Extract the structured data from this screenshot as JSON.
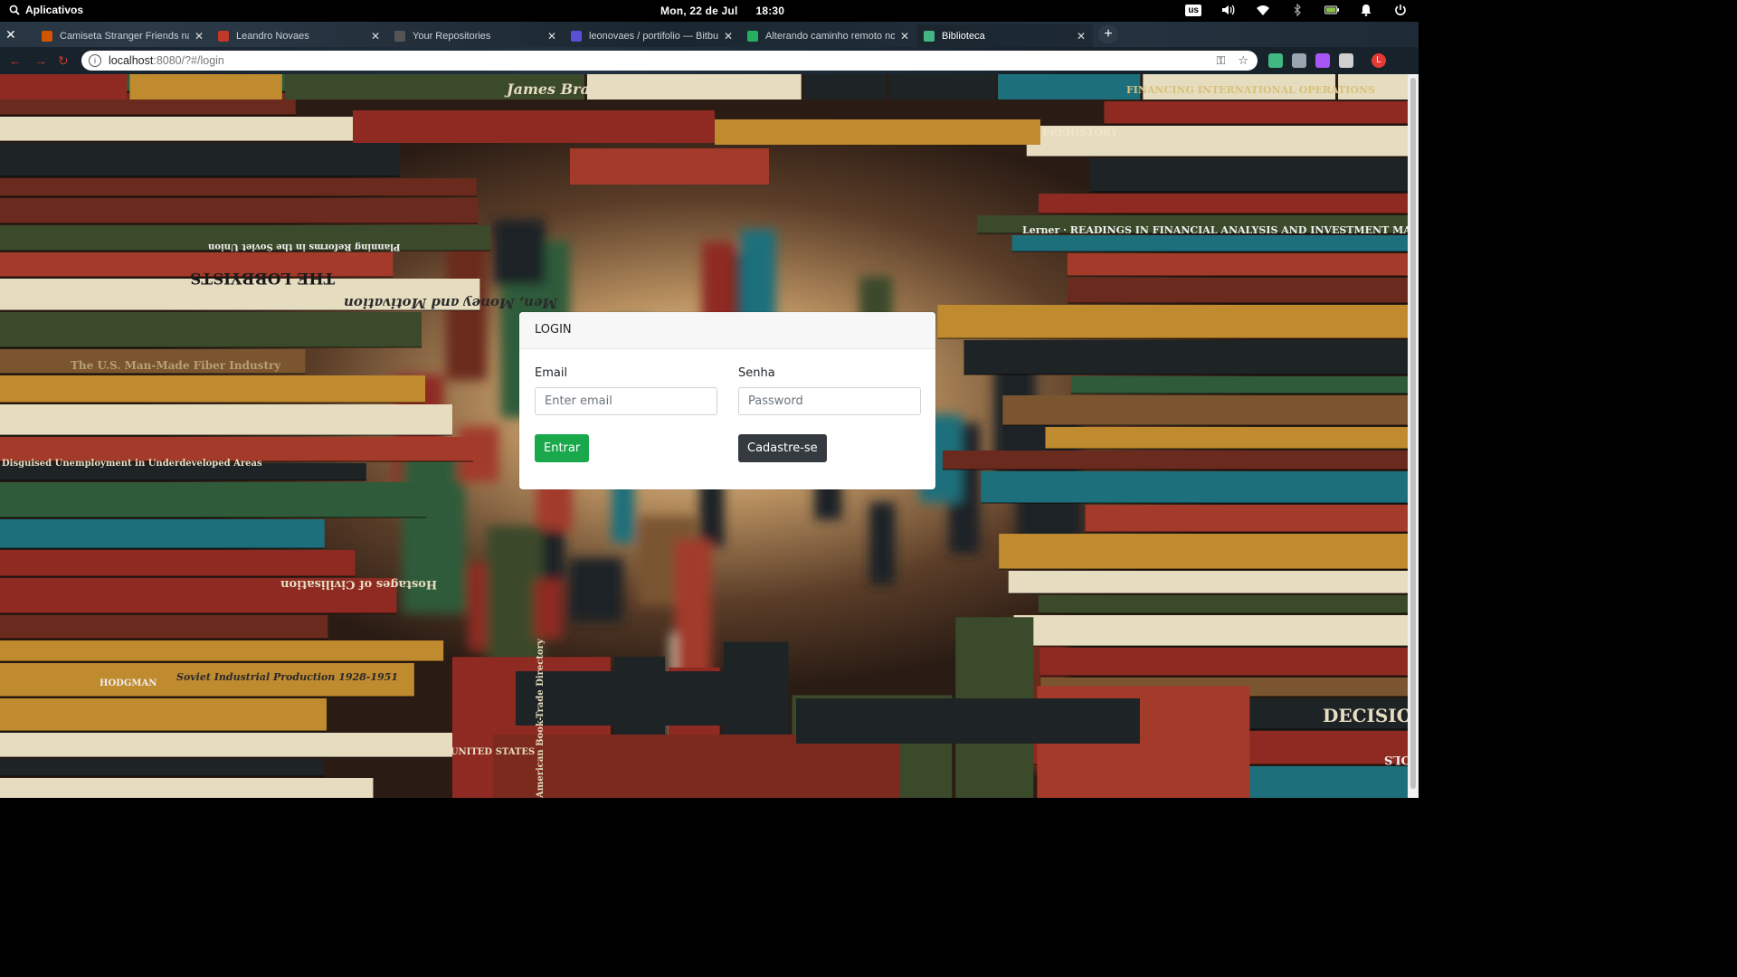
{
  "system_bar": {
    "apps_label": "Aplicativos",
    "date": "Mon, 22 de Jul",
    "time": "18:30",
    "keyboard_layout": "us"
  },
  "browser": {
    "tabs": [
      {
        "title": "Camiseta Stranger Friends na",
        "favicon_color": "#d35400",
        "active": false
      },
      {
        "title": "Leandro Novaes",
        "favicon_color": "#c0392b",
        "active": false
      },
      {
        "title": "Your Repositories",
        "favicon_color": "#555555",
        "active": false
      },
      {
        "title": "leonovaes / portifolio — Bitbu",
        "favicon_color": "#5b4fd6",
        "active": false
      },
      {
        "title": "Alterando caminho remoto no",
        "favicon_color": "#27ae60",
        "active": false
      },
      {
        "title": "Biblioteca",
        "favicon_color": "#41b883",
        "active": true
      }
    ],
    "url_host": "localhost",
    "url_rest": ":8080/?#/login",
    "extension_colors": [
      "#41b883",
      "#9aa5b1",
      "#a855f7",
      "#cfcfcf",
      "#e53935"
    ],
    "profile_initial": "L"
  },
  "login": {
    "header": "LOGIN",
    "email_label": "Email",
    "email_placeholder": "Enter email",
    "email_value": "",
    "password_label": "Senha",
    "password_placeholder": "Password",
    "password_value": "",
    "submit_label": "Entrar",
    "signup_label": "Cadastre-se"
  },
  "background": {
    "book_spines": [
      "James Branch Cabell · BREWER",
      "FINANCING INTERNATIONAL OPERATIONS",
      "PREHISTORY",
      "THE LOBBYISTS",
      "Planning Reforms in the Soviet Union",
      "Men, Money and Motivation",
      "The U.S. Man-Made Fiber Industry",
      "Disguised Unemployment in Underdeveloped Areas",
      "Lerner · READINGS IN FINANCIAL ANALYSIS AND INVESTMENT MANAGEMENT",
      "Hostages of Civilisation",
      "HODGMAN",
      "Soviet Industrial Production 1928-1951",
      "A HISTORY OF PHYSICAL EDUCATION IN THE UNITED STATES",
      "American Book-Trade Directory",
      "ECONOMIC CONTROLS",
      "DECISION"
    ],
    "colors": {
      "red": "#8e2a22",
      "green": "#2f5b3a",
      "teal": "#1d6f7c",
      "gold": "#c08a2e",
      "dark": "#1e2326",
      "cream": "#e6dcc0"
    }
  }
}
